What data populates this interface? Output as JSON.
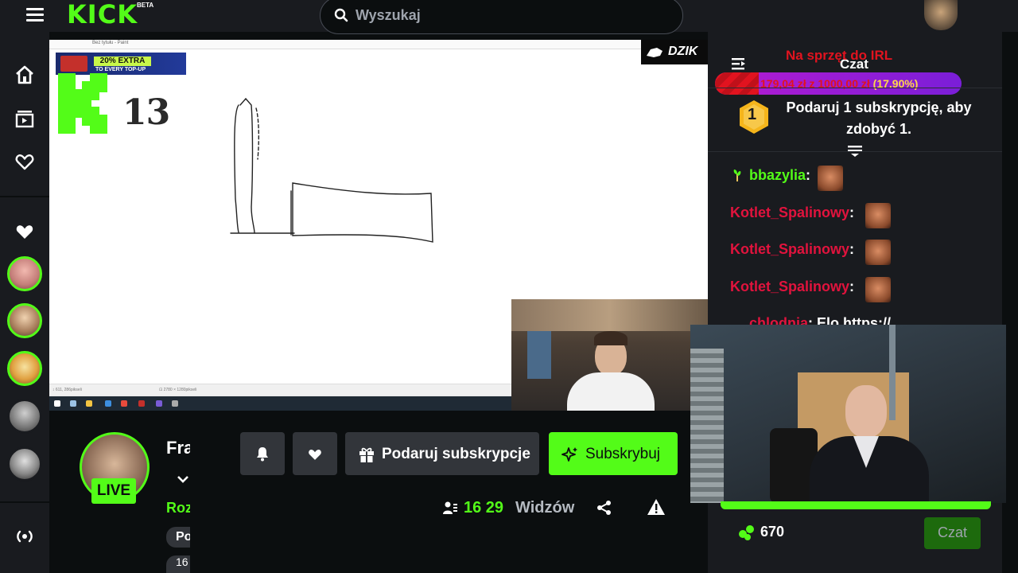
{
  "app": {
    "logo": "KICK",
    "logo_badge": "BETA"
  },
  "search": {
    "placeholder": "Wyszukaj"
  },
  "stream": {
    "paint_title": "Bez tytułu - Paint",
    "promo_badge": "20% EXTRA",
    "promo_sub": "TO EVERY TOP-UP",
    "overlay_number": "13",
    "sponsor": "DZIK",
    "statusbar_left": "↕ 611, 286pikseli",
    "statusbar_size": "⊡ 2780 × 1280pikseli"
  },
  "channel": {
    "live_label": "LIVE",
    "name_partial": "Fra",
    "category_partial": "Roz",
    "tag_partial": "Po",
    "tag2_partial": "16",
    "gift_label": "Podaruj subskrypcje",
    "subscribe_label": "Subskrybuj",
    "viewers_count": "16 29",
    "viewers_label": "Widzów"
  },
  "chat": {
    "title": "Czat",
    "goal_title": "Na sprzęt do IRL",
    "goal_amount": "179,04 zł z 1000,00 zł",
    "goal_percent": "(17.90%)",
    "goal_fraction": 0.179,
    "gift_rank": "1",
    "gift_prompt": "Podaruj 1 subskrypcję, aby zdobyć 1.",
    "messages": [
      {
        "user": "bbazylia",
        "color": "#53fc18"
      },
      {
        "user": "Kotlet_Spalinowy",
        "color": "#e1133d"
      },
      {
        "user": "Kotlet_Spalinowy",
        "color": "#e1133d"
      },
      {
        "user": "Kotlet_Spalinowy",
        "color": "#e1133d"
      },
      {
        "user": "chlodnia",
        "color": "#e1133d",
        "text": "Elo https://"
      }
    ],
    "points": "670",
    "send_label": "Czat"
  },
  "colors": {
    "brand": "#53fc18",
    "bg": "#0b0e0f",
    "panel": "#191b1f",
    "button": "#32353a"
  }
}
